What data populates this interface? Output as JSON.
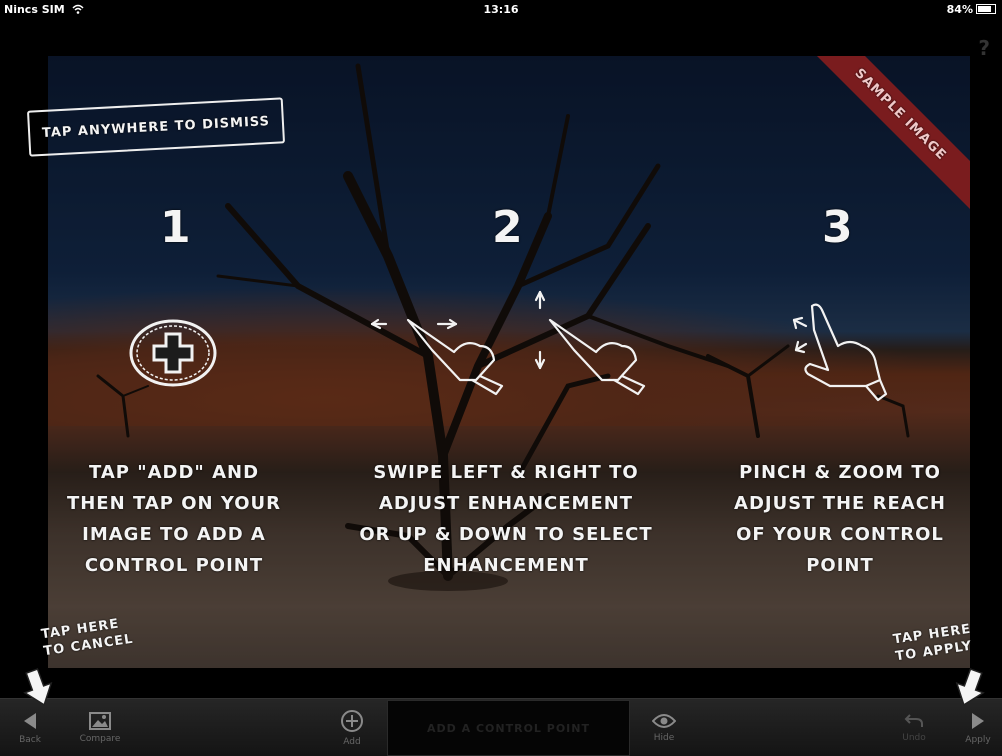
{
  "status": {
    "carrier": "Nincs SIM",
    "time": "13:16",
    "battery": "84%"
  },
  "help_glyph": "?",
  "overlay": {
    "dismiss": "TAP ANYWHERE TO DISMISS",
    "sample_ribbon": "SAMPLE IMAGE",
    "steps": [
      {
        "number": "1",
        "lines": [
          "TAP \"ADD\" AND",
          "THEN TAP ON YOUR",
          "IMAGE TO ADD A",
          "CONTROL POINT"
        ]
      },
      {
        "number": "2",
        "lines": [
          "SWIPE LEFT & RIGHT TO",
          "ADJUST ENHANCEMENT",
          "OR UP & DOWN TO SELECT",
          "ENHANCEMENT"
        ]
      },
      {
        "number": "3",
        "lines": [
          "PINCH & ZOOM TO",
          "ADJUST THE REACH",
          "OF YOUR CONTROL",
          "POINT"
        ]
      }
    ],
    "tip_cancel": [
      "TAP HERE",
      "TO CANCEL"
    ],
    "tip_apply": [
      "TAP HERE",
      "TO APPLY"
    ]
  },
  "toolbar": {
    "back": "Back",
    "compare": "Compare",
    "add": "Add",
    "add_control_point": "ADD A CONTROL POINT",
    "hide": "Hide",
    "undo": "Undo",
    "apply": "Apply"
  },
  "icons": [
    "wifi-icon",
    "battery-icon",
    "help-icon",
    "back-arrow-icon",
    "compare-image-icon",
    "add-circle-icon",
    "eye-icon",
    "undo-icon",
    "apply-arrow-icon",
    "add-point-badge-icon",
    "swipe-hand-icon",
    "pinch-hand-icon"
  ]
}
